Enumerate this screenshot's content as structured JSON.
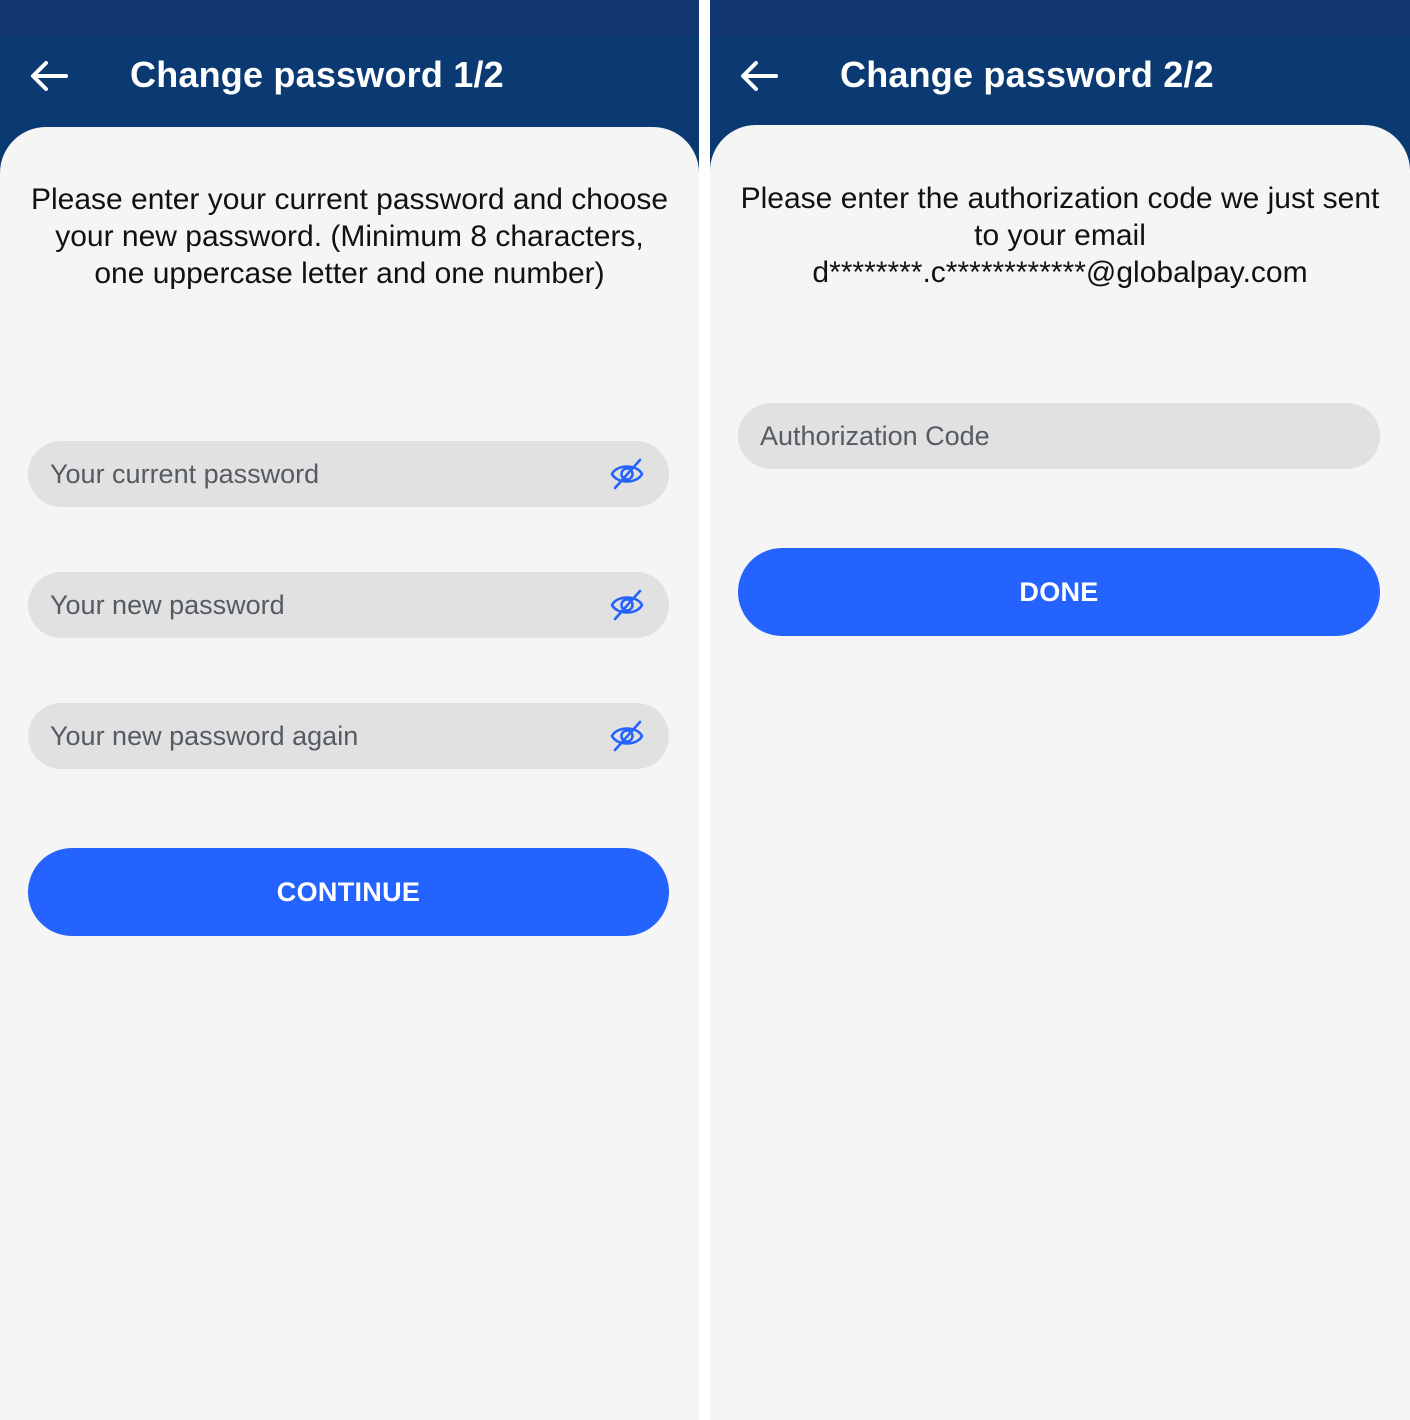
{
  "screens": [
    {
      "title": "Change password 1/2",
      "instructions": "Please enter your current password and choose your new password. (Minimum 8 characters, one uppercase letter and one number)",
      "fields": [
        {
          "placeholder": "Your current password",
          "icon": "eye-slash-icon"
        },
        {
          "placeholder": "Your new password",
          "icon": "eye-slash-icon"
        },
        {
          "placeholder": "Your new password again",
          "icon": "eye-slash-icon"
        }
      ],
      "button_label": "CONTINUE"
    },
    {
      "title": "Change password 2/2",
      "instructions": "Please enter the authorization code we just sent to your email d********.c************@globalpay.com",
      "fields": [
        {
          "placeholder": "Authorization Code"
        }
      ],
      "button_label": "DONE"
    }
  ],
  "colors": {
    "status_bar": "#123670",
    "app_bar": "#0b3a73",
    "card_background": "#f5f5f5",
    "field_background": "#e1e1e1",
    "primary_button": "#2563ff",
    "icon_accent": "#2563ff"
  },
  "icons": {
    "back": "arrow-left-icon",
    "password_visibility": "eye-slash-icon"
  }
}
